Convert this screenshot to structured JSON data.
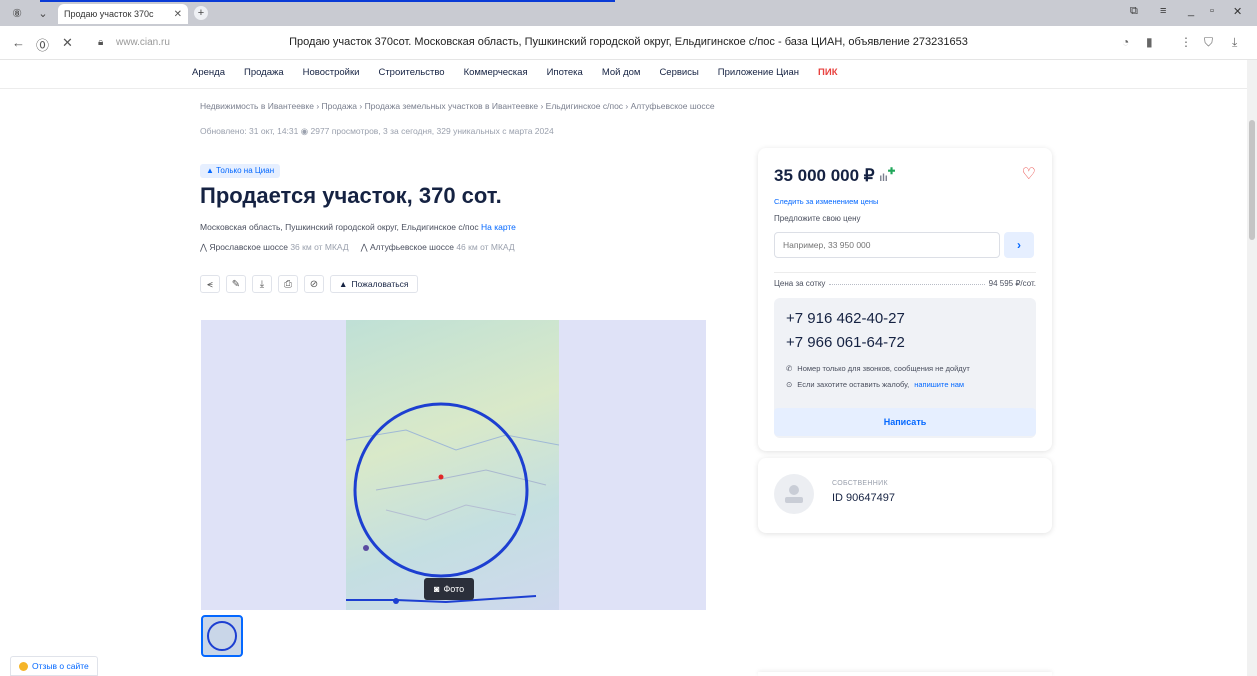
{
  "browser": {
    "tab_title": "Продаю участок 370с",
    "domain": "www.cian.ru",
    "page_title": "Продаю участок 370сот. Московская область, Пушкинский городской округ, Ельдигинское с/пос - база ЦИАН, объявление 273231653"
  },
  "nav": {
    "items": [
      "Аренда",
      "Продажа",
      "Новостройки",
      "Строительство",
      "Коммерческая",
      "Ипотека",
      "Мой дом",
      "Сервисы",
      "Приложение Циан",
      "ПИК"
    ]
  },
  "breadcrumb": "Недвижимость в Ивантеевке  ›  Продажа  ›  Продажа земельных участков в Ивантеевке  ›  Ельдигинское с/пос  ›  Алтуфьевское шоссе",
  "meta": "Обновлено: 31 окт, 14:31   ◉  2977 просмотров, 3 за сегодня, 329 уникальных с марта 2024",
  "listing": {
    "badge": "Только на Циан",
    "title": "Продается участок, 370 сот.",
    "address": "Московская область, Пушкинский городской округ, Ельдигинское с/пос",
    "map_link": "На карте",
    "highway1_name": "Ярославское шоссе",
    "highway1_dist": "36 км от МКАД",
    "highway2_name": "Алтуфьевское шоссе",
    "highway2_dist": "46 км от МКАД",
    "complain_label": "Пожаловаться",
    "photo_button": "Фото"
  },
  "sidebar": {
    "price": "35 000 000 ₽",
    "follow_price": "Следить за изменением цены",
    "offer_label": "Предложите свою цену",
    "offer_placeholder": "Например, 33 950 000",
    "price_per_unit_label": "Цена за сотку",
    "price_per_unit_value": "94 595 ₽/сот.",
    "phone1": "+7 916 462-40-27",
    "phone2": "+7 966 061-64-72",
    "note1": "Номер только для звонков, сообщения не дойдут",
    "note2_text": "Если захотите оставить жалобу,",
    "note2_link": "напишите нам",
    "write_button": "Написать"
  },
  "owner": {
    "role": "СОБСТВЕННИК",
    "id": "ID 90647497"
  },
  "feedback": "Отзыв о сайте",
  "colors": {
    "accent": "#0468ff",
    "brand_pik": "#e8413e",
    "text": "#152242"
  }
}
